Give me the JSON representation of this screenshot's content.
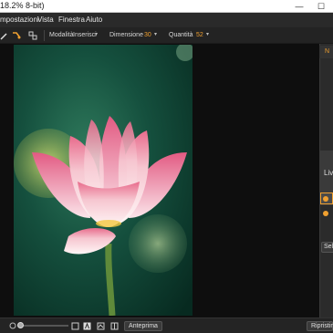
{
  "titlebar": {
    "title": "18.2% 8-bit)",
    "minimize": "—",
    "maximize": "☐"
  },
  "menu": {
    "items": [
      "mpostazioni",
      "Vista",
      "Finestra",
      "Aiuto"
    ]
  },
  "toolbar": {
    "mode_label": "Modalità",
    "mode_value": "Inserisci",
    "size_label": "Dimensione",
    "size_value": "30",
    "qty_label": "Quantità",
    "qty_value": "52"
  },
  "right_panel": {
    "tab_label": "N",
    "layer_label": "Liv",
    "button_label": "Sel"
  },
  "bottombar": {
    "preview_label": "Anteprima",
    "reset_label": "Ripristin"
  },
  "colors": {
    "accent": "#f0a030"
  }
}
